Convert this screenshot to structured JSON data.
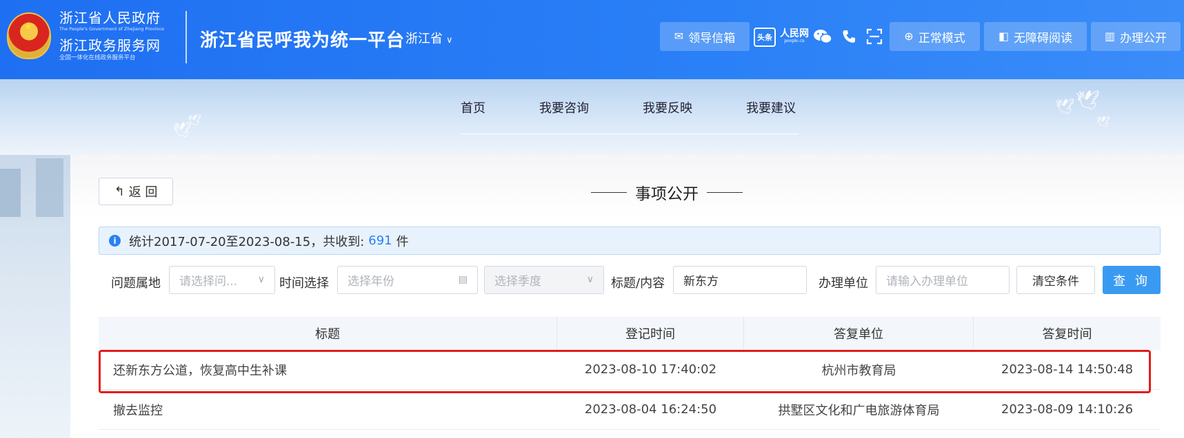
{
  "header": {
    "gov_name": "浙江省人民政府",
    "gov_name_en": "The People's Government of Zhejiang Province",
    "service_name": "浙江政务服务网",
    "service_sub": "全国一体化在线政务服务平台",
    "platform_title": "浙江省民呼我为统一平台",
    "region": "浙江省",
    "buttons": {
      "mail": "领导信箱",
      "normal_mode": "正常模式",
      "accessible": "无障碍阅读",
      "open": "办理公开"
    },
    "toutiao": "头条",
    "people": "人民网",
    "people_sub": "people.cn"
  },
  "nav": {
    "items": [
      "首页",
      "我要咨询",
      "我要反映",
      "我要建议"
    ]
  },
  "page": {
    "back_label": "返 回",
    "section_title": "事项公开"
  },
  "stats": {
    "prefix": "统计2017-07-20至2023-08-15，共收到:",
    "count": "691",
    "suffix": "件"
  },
  "filters": {
    "location_label": "问题属地",
    "location_placeholder": "请选择问...",
    "time_label": "时间选择",
    "year_placeholder": "选择年份",
    "quarter_placeholder": "选择季度",
    "keyword_label": "标题/内容",
    "keyword_value": "新东方",
    "unit_label": "办理单位",
    "unit_placeholder": "请输入办理单位",
    "clear_label": "清空条件",
    "query_label": "查 询"
  },
  "table": {
    "headers": [
      "标题",
      "登记时间",
      "答复单位",
      "答复时间"
    ],
    "rows": [
      {
        "title": "还新东方公道，恢复高中生补课",
        "registered": "2023-08-10 17:40:02",
        "unit": "杭州市教育局",
        "replied": "2023-08-14 14:50:48"
      },
      {
        "title": "撤去监控",
        "registered": "2023-08-04 16:24:50",
        "unit": "拱墅区文化和广电旅游体育局",
        "replied": "2023-08-09 14:10:26"
      }
    ]
  },
  "colors": {
    "header_blue": "#2a80f6",
    "highlight_red": "#e31b1b",
    "query_blue": "#3a9af2"
  }
}
